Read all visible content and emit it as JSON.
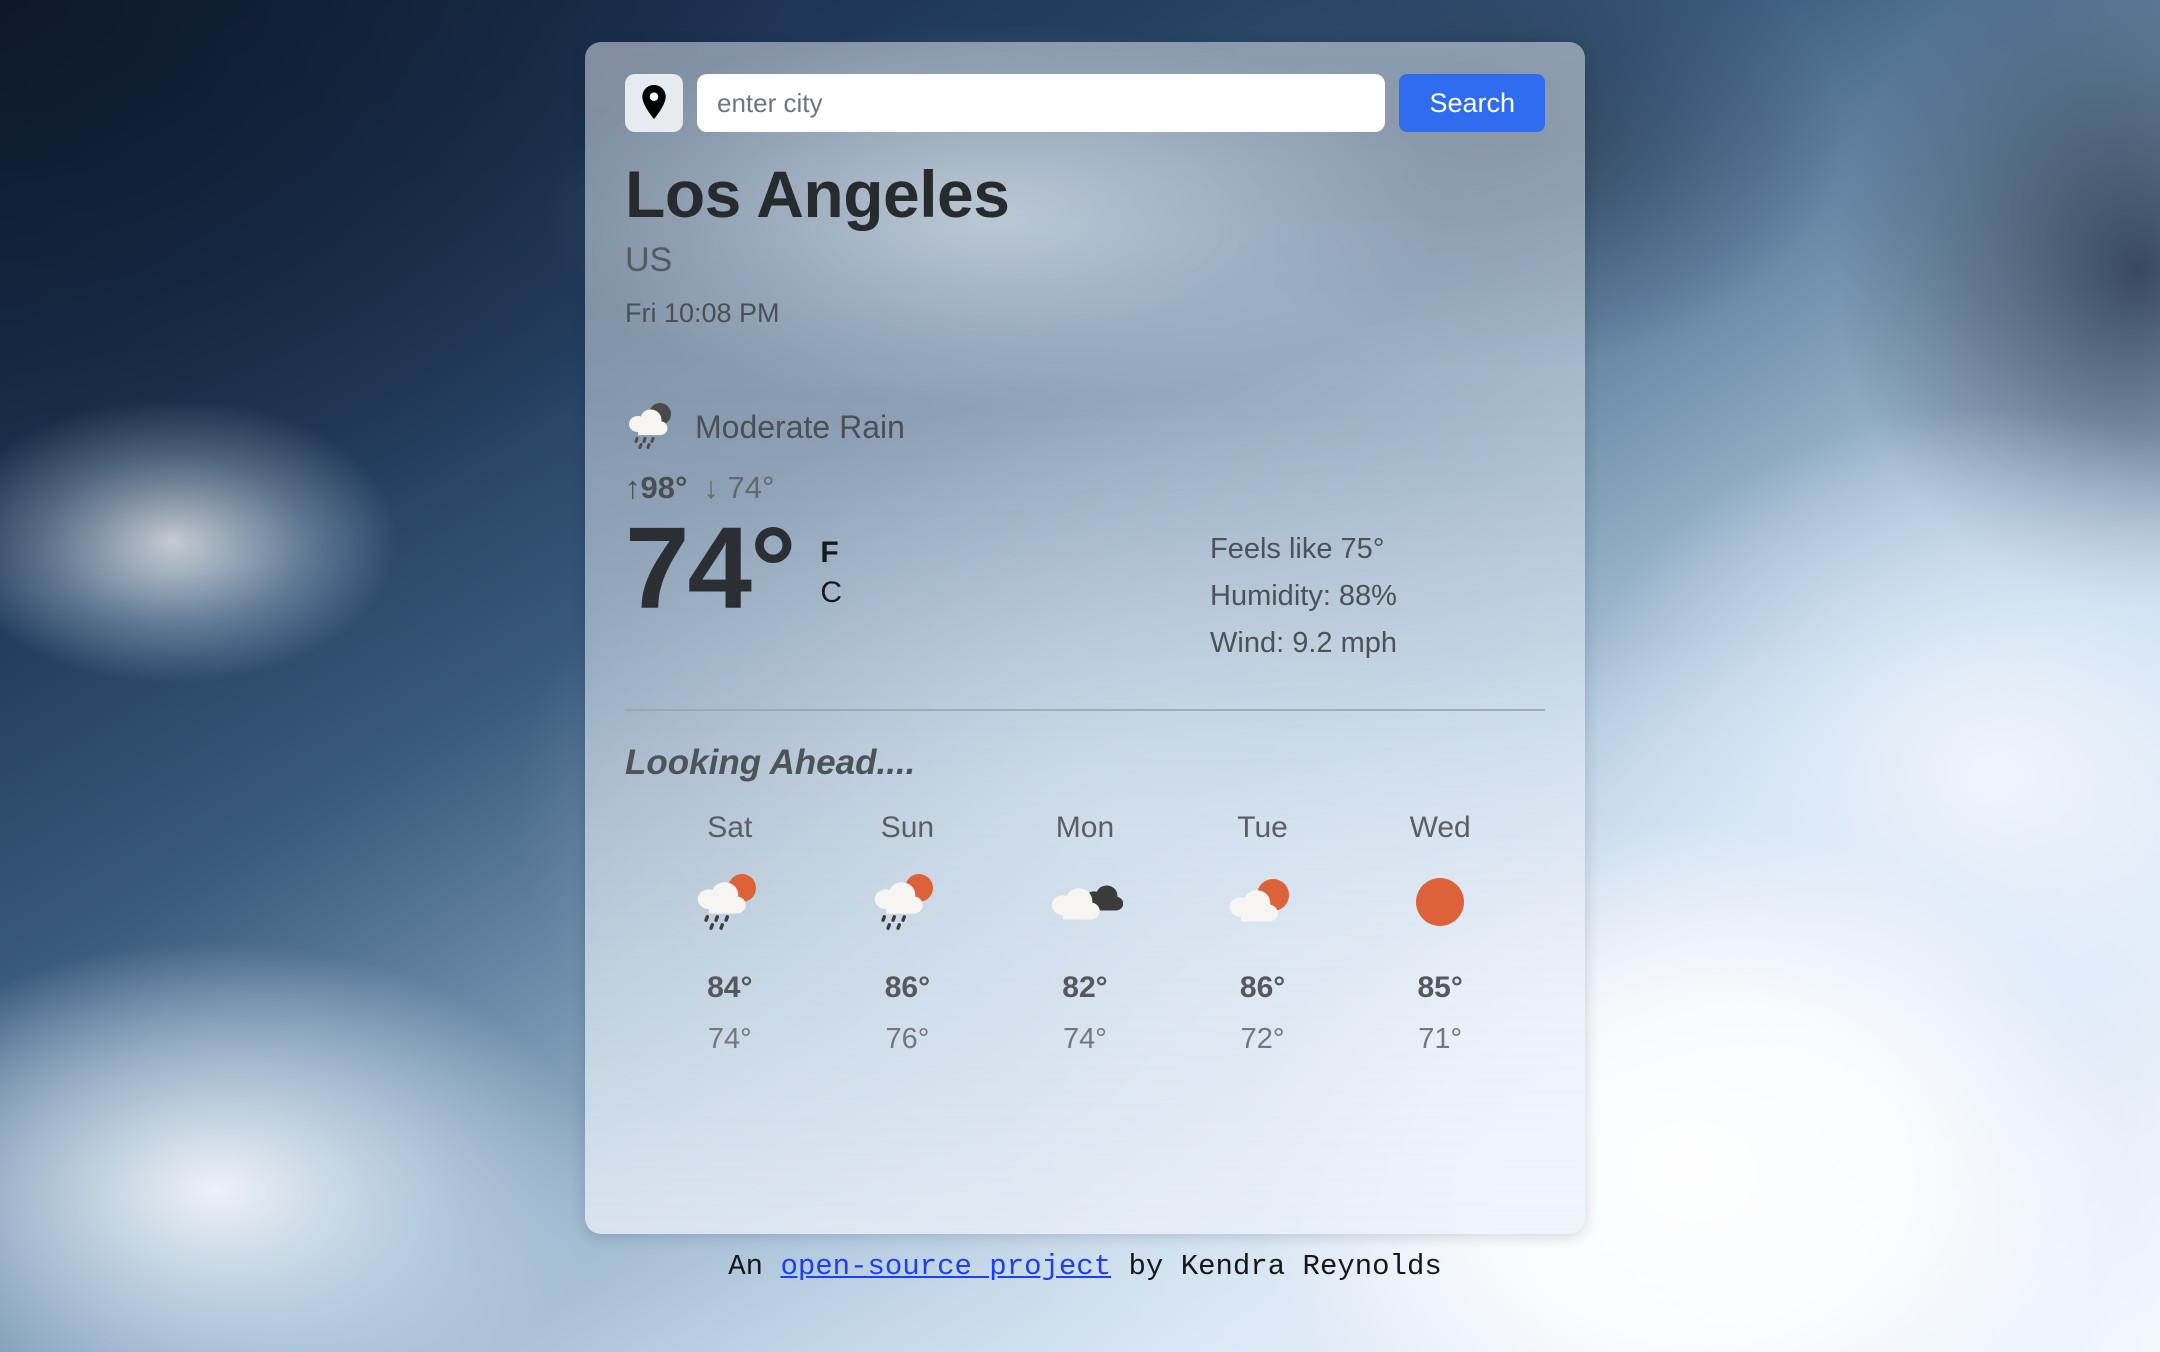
{
  "search": {
    "pin_icon": "location-pin-icon",
    "placeholder": "enter city",
    "value": "",
    "button_label": "Search"
  },
  "location": {
    "city": "Los Angeles",
    "country": "US",
    "local_time": "Fri 10:08 PM"
  },
  "current": {
    "condition_icon": "rain-cloud-night-icon",
    "condition": "Moderate Rain",
    "high": "↑98°",
    "low": "↓ 74°",
    "temperature": "74°",
    "units": {
      "fahrenheit": "F",
      "celsius": "C",
      "active": "F"
    },
    "feels_like": "Feels like 75°",
    "humidity": "Humidity: 88%",
    "wind": "Wind: 9.2 mph"
  },
  "forecast": {
    "title": "Looking Ahead....",
    "days": [
      {
        "label": "Sat",
        "icon": "sun-rain-cloud-icon",
        "high": "84°",
        "low": "74°"
      },
      {
        "label": "Sun",
        "icon": "sun-rain-cloud-icon",
        "high": "86°",
        "low": "76°"
      },
      {
        "label": "Mon",
        "icon": "dark-clouds-icon",
        "high": "82°",
        "low": "74°"
      },
      {
        "label": "Tue",
        "icon": "sun-behind-cloud-icon",
        "high": "86°",
        "low": "72°"
      },
      {
        "label": "Wed",
        "icon": "sun-icon",
        "high": "85°",
        "low": "71°"
      }
    ]
  },
  "footer": {
    "prefix": "An ",
    "link": "open-source project",
    "suffix": " by Kendra Reynolds"
  },
  "colors": {
    "accent_blue": "#2f6cf0",
    "link_blue": "#1a40f0",
    "sun_orange": "#dd6239",
    "cloud_white": "#f7f5f1",
    "cloud_dark": "#3b3b3b"
  }
}
